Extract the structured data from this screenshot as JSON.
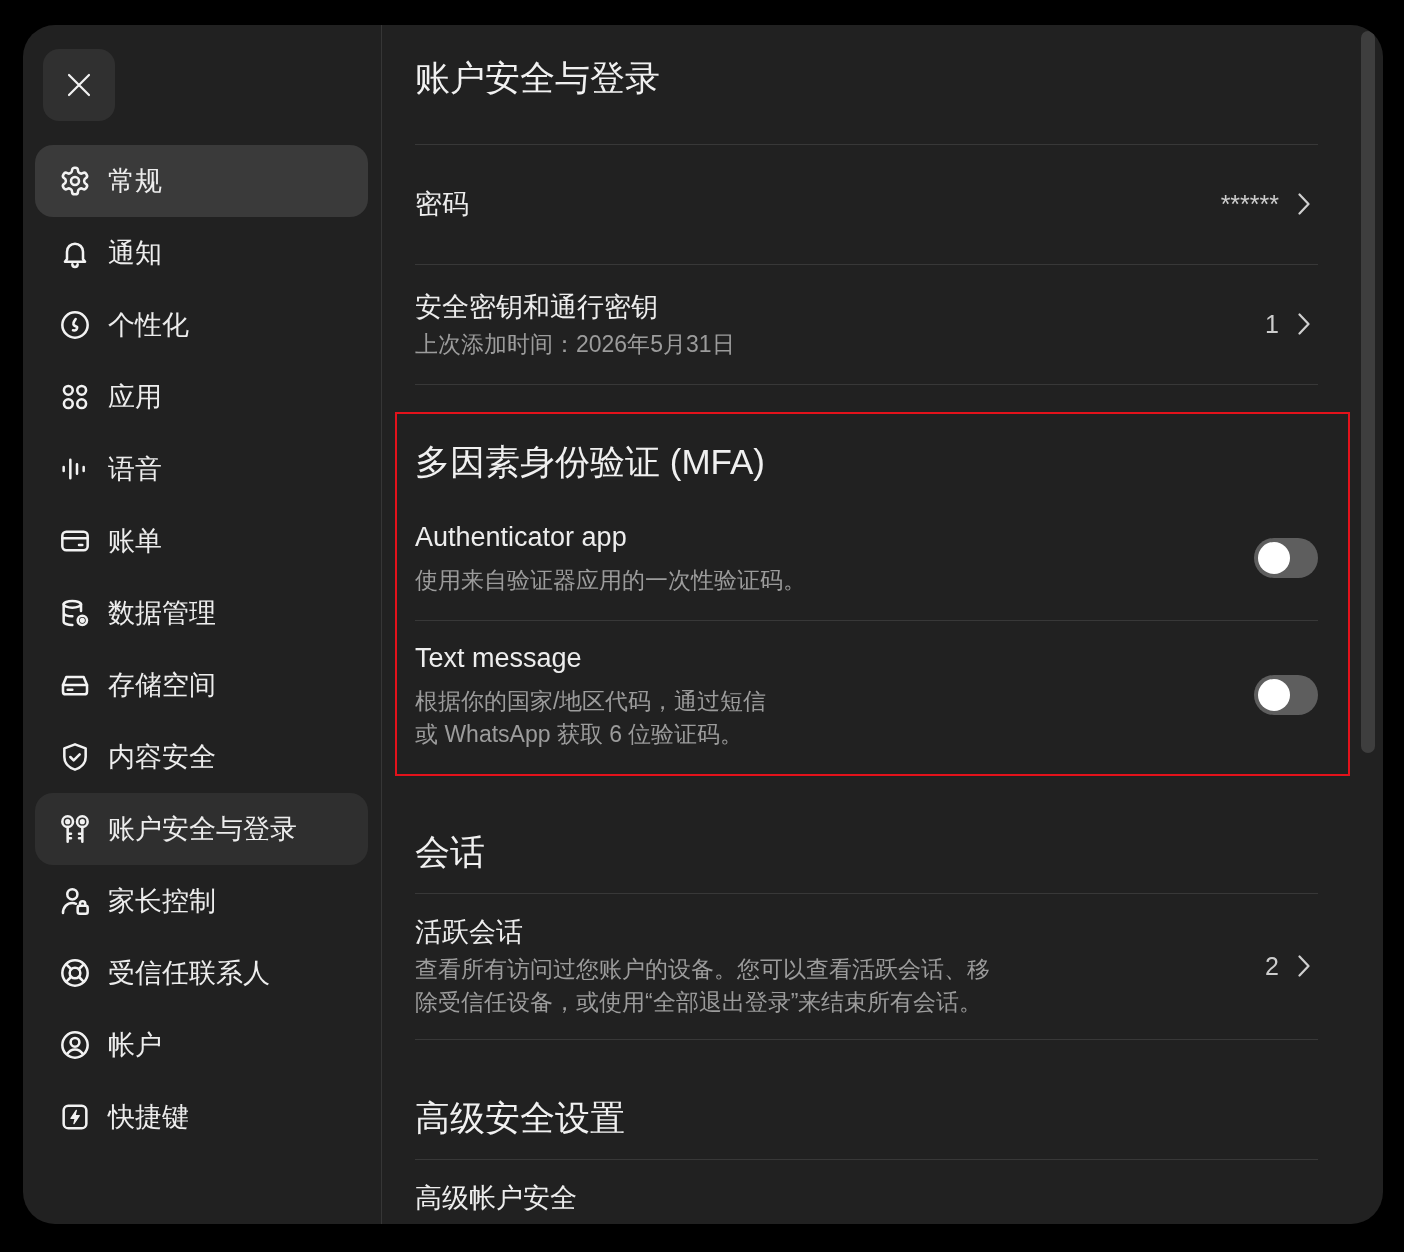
{
  "sidebar": {
    "items": [
      {
        "label": "常规",
        "selected": false,
        "hovered": true
      },
      {
        "label": "通知",
        "selected": false,
        "hovered": false
      },
      {
        "label": "个性化",
        "selected": false,
        "hovered": false
      },
      {
        "label": "应用",
        "selected": false,
        "hovered": false
      },
      {
        "label": "语音",
        "selected": false,
        "hovered": false
      },
      {
        "label": "账单",
        "selected": false,
        "hovered": false
      },
      {
        "label": "数据管理",
        "selected": false,
        "hovered": false
      },
      {
        "label": "存储空间",
        "selected": false,
        "hovered": false
      },
      {
        "label": "内容安全",
        "selected": false,
        "hovered": false
      },
      {
        "label": "账户安全与登录",
        "selected": true,
        "hovered": false
      },
      {
        "label": "家长控制",
        "selected": false,
        "hovered": false
      },
      {
        "label": "受信任联系人",
        "selected": false,
        "hovered": false
      },
      {
        "label": "帐户",
        "selected": false,
        "hovered": false
      },
      {
        "label": "快捷键",
        "selected": false,
        "hovered": false
      }
    ]
  },
  "sections": [
    {
      "kind": "links",
      "title": "账户安全与登录",
      "highlighted": false,
      "rows": [
        {
          "label": "密码",
          "value": "******"
        },
        {
          "label": "安全密钥和通行密钥",
          "description": "上次添加时间：2026年5月31日",
          "value": "1"
        }
      ]
    },
    {
      "kind": "toggles",
      "title": "多因素身份验证 (MFA)",
      "highlighted": true,
      "rows": [
        {
          "label": "Authenticator app",
          "description_lines": [
            "使用来自验证器应用的一次性验证码。"
          ],
          "on": false
        },
        {
          "label": "Text message",
          "description_lines": [
            "根据你的国家/地区代码，通过短信",
            "或 WhatsApp 获取 6 位验证码。"
          ],
          "on": false
        }
      ]
    },
    {
      "kind": "links",
      "title": "会话",
      "highlighted": false,
      "rows": [
        {
          "label": "活跃会话",
          "description": "查看所有访问过您账户的设备。您可以查看活跃会话、移除受信任设备，或使用“全部退出登录”来结束所有会话。",
          "value": "2"
        }
      ]
    },
    {
      "kind": "links",
      "title": "高级安全设置",
      "highlighted": false,
      "rows": [
        {
          "label": "高级帐户安全"
        }
      ]
    }
  ]
}
